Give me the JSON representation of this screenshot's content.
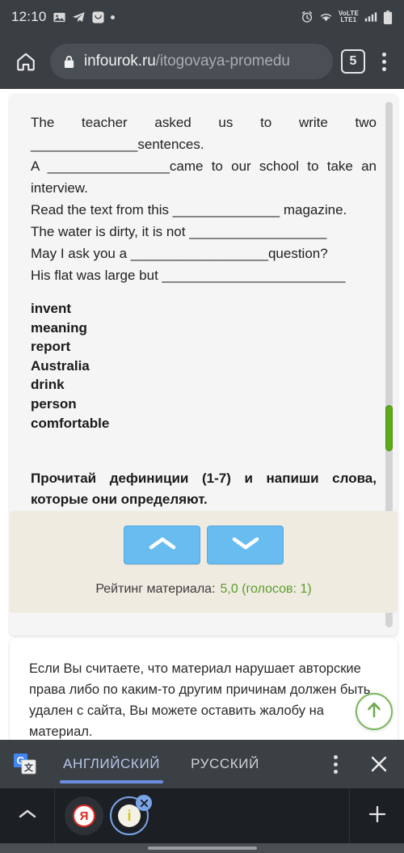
{
  "status_bar": {
    "time": "12:10",
    "left_icons": [
      "photo-icon",
      "telegram-icon",
      "viber-icon",
      "dot-indicator-icon"
    ],
    "right_icons": [
      "alarm-icon",
      "wifi-icon",
      "volte-icon",
      "signal-icon",
      "battery-icon"
    ],
    "network_label_top": "VoLTE",
    "network_label_bottom": "LTE1"
  },
  "browser": {
    "home_icon": "home-icon",
    "lock_icon": "lock-icon",
    "url_domain": "infourok.ru",
    "url_path": "/itogovaya-promedu",
    "tab_count": "5",
    "menu_icon": "kebab-menu-icon"
  },
  "content": {
    "sentences": [
      "The teacher asked us to write two ______________sentences.",
      "A ________________came to our school to take an interview.",
      "Read the text from this ______________ magazine.",
      "The water is dirty, it is not __________________",
      "May I ask you a __________________question?",
      "His flat was large but ________________________"
    ],
    "word_bank": [
      "invent",
      "meaning",
      "report",
      "Australia",
      "drink",
      "person",
      "comfortable"
    ],
    "instruction": "Прочитай дефиниции (1-7) и напиши слова, которые они определяют.",
    "scrollbar_thumb_color": "#5caa17"
  },
  "rating": {
    "vote_up_icon": "chevron-up-icon",
    "vote_down_icon": "chevron-down-icon",
    "label": "Рейтинг материала:",
    "value": "5,0 (голосов: 1)",
    "value_color": "#5a9e28",
    "button_color": "#68bcf0",
    "box_color": "#efebe1"
  },
  "complaint": {
    "text": "Если Вы считаете, что материал нарушает авторские права либо по каким-то другим причинам должен быть удален с сайта, Вы можете оставить жалобу на материал."
  },
  "scroll_top_fab": {
    "icon": "arrow-up-icon",
    "border_color": "#7ab85a"
  },
  "translate_bar": {
    "logo_icon": "google-translate-icon",
    "languages": [
      {
        "label": "АНГЛИЙСКИЙ",
        "active": true
      },
      {
        "label": "РУССКИЙ",
        "active": false
      }
    ],
    "menu_icon": "kebab-menu-icon",
    "close_icon": "close-icon",
    "accent_color": "#6b8ee0"
  },
  "tab_strip": {
    "collapse_icon": "chevron-up-icon",
    "tabs": [
      {
        "favicon_label": "Я",
        "name": "yandex-tab",
        "active": false
      },
      {
        "favicon_label": "i",
        "name": "infourok-tab",
        "active": true,
        "close_icon": "close-icon"
      }
    ],
    "new_tab_icon": "plus-icon"
  }
}
